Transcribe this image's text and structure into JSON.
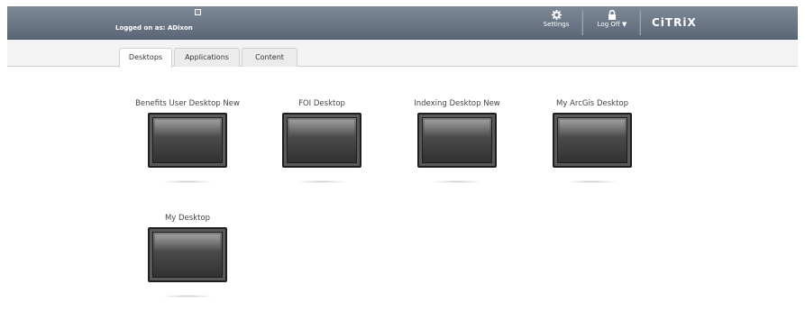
{
  "header": {
    "logged_on": "Logged on as: ADixon",
    "settings_label": "Settings",
    "logoff_label": "Log Off ▼",
    "brand": "CiTRiX"
  },
  "tabs": [
    {
      "label": "Desktops",
      "active": true
    },
    {
      "label": "Applications",
      "active": false
    },
    {
      "label": "Content",
      "active": false
    }
  ],
  "desktops": [
    {
      "label": "Benefits User Desktop New"
    },
    {
      "label": "FOI Desktop"
    },
    {
      "label": "Indexing Desktop New"
    },
    {
      "label": "My ArcGis Desktop"
    },
    {
      "label": "My Desktop"
    }
  ],
  "colors": {
    "header_bg": "#6b7686",
    "tab_bg": "#f3f3f3"
  }
}
